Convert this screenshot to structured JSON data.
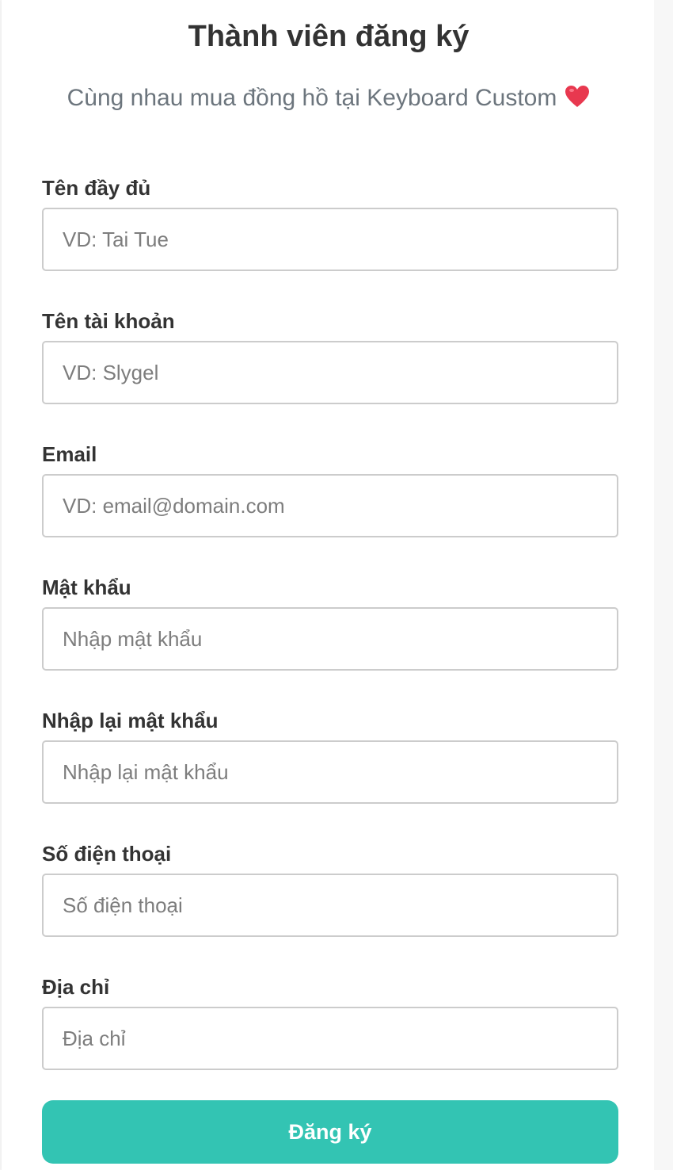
{
  "page": {
    "title": "Thành viên đăng ký",
    "subtitle": "Cùng nhau mua đồng hồ tại Keyboard Custom",
    "subtitle_icon": "heart-icon"
  },
  "form": {
    "fields": [
      {
        "label": "Tên đầy đủ",
        "placeholder": "VD: Tai Tue",
        "value": ""
      },
      {
        "label": "Tên tài khoản",
        "placeholder": "VD: Slygel",
        "value": ""
      },
      {
        "label": "Email",
        "placeholder": "VD: email@domain.com",
        "value": ""
      },
      {
        "label": "Mật khẩu",
        "placeholder": "Nhập mật khẩu",
        "value": ""
      },
      {
        "label": "Nhập lại mật khẩu",
        "placeholder": "Nhập lại mật khẩu",
        "value": ""
      },
      {
        "label": "Số điện thoại",
        "placeholder": "Số điện thoại",
        "value": ""
      },
      {
        "label": "Địa chỉ",
        "placeholder": "Địa chỉ",
        "value": ""
      }
    ],
    "submit_label": "Đăng ký"
  },
  "colors": {
    "accent": "#33c4b3",
    "heart": "#e8384f",
    "title_text": "#333333",
    "subtitle_text": "#6c757d"
  }
}
